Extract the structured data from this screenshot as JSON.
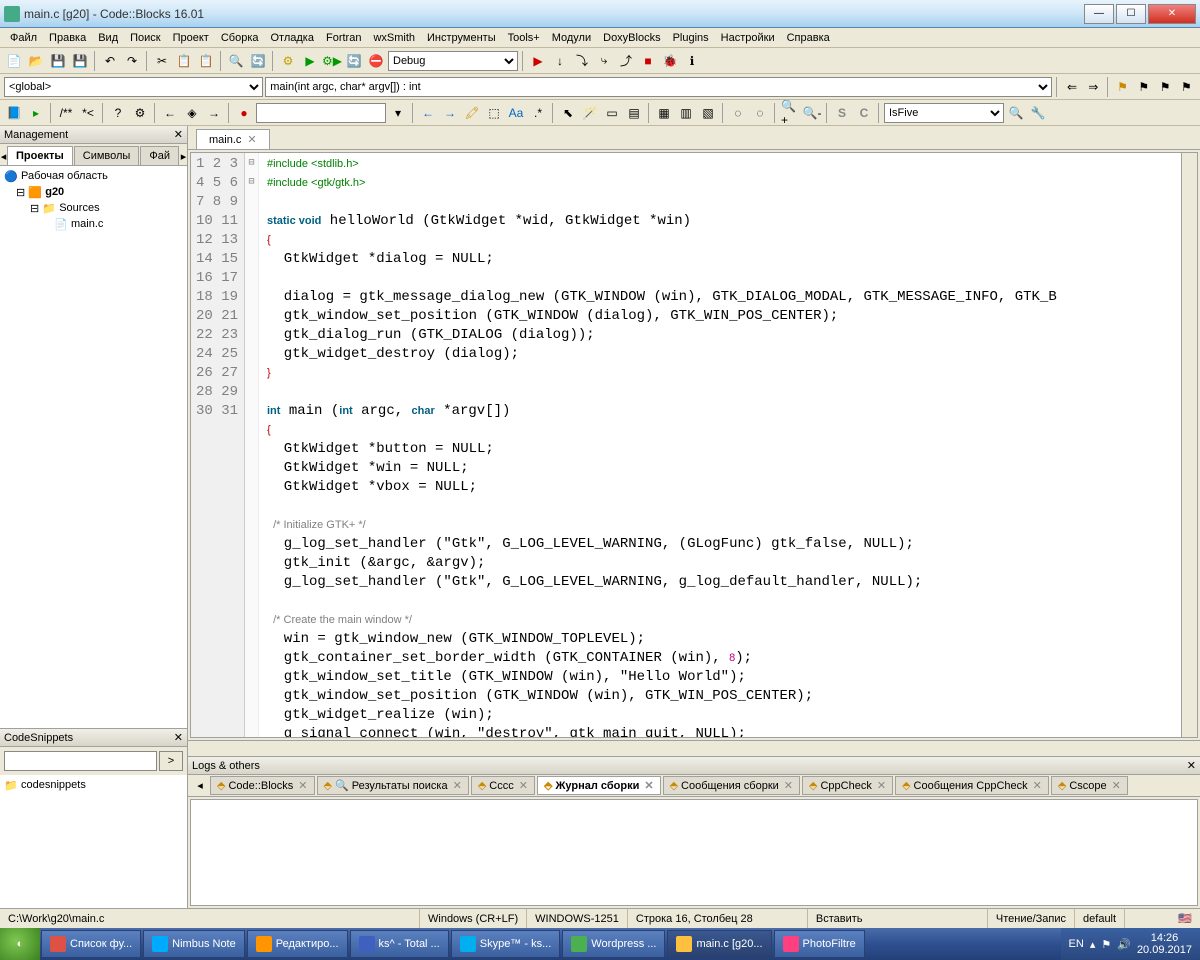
{
  "window": {
    "title": "main.c [g20] - Code::Blocks 16.01"
  },
  "menu": [
    "Файл",
    "Правка",
    "Вид",
    "Поиск",
    "Проект",
    "Сборка",
    "Отладка",
    "Fortran",
    "wxSmith",
    "Инструменты",
    "Tools+",
    "Модули",
    "DoxyBlocks",
    "Plugins",
    "Настройки",
    "Справка"
  ],
  "toolbar2": {
    "target": "Debug"
  },
  "toolbar3": {
    "scope": "<global>",
    "func": "main(int argc, char* argv[]) : int"
  },
  "toolbar5": {
    "id": "IsFive"
  },
  "sidebar": {
    "title": "Management",
    "tabs": [
      "Проекты",
      "Символы",
      "Фай"
    ],
    "tree": {
      "workspace": "Рабочая область",
      "project": "g20",
      "folder": "Sources",
      "file": "main.c"
    }
  },
  "snippets": {
    "title": "CodeSnippets",
    "root": "codesnippets"
  },
  "file_tab": "main.c",
  "code_lines": [
    {
      "n": 1,
      "t": "pp",
      "s": "#include <stdlib.h>"
    },
    {
      "n": 2,
      "t": "pp",
      "s": "#include <gtk/gtk.h>"
    },
    {
      "n": 3,
      "t": "",
      "s": ""
    },
    {
      "n": 4,
      "t": "mix",
      "s": "static void helloWorld (GtkWidget *wid, GtkWidget *win)"
    },
    {
      "n": 5,
      "t": "br",
      "s": "{"
    },
    {
      "n": 6,
      "t": "",
      "s": "  GtkWidget *dialog = NULL;"
    },
    {
      "n": 7,
      "t": "",
      "s": ""
    },
    {
      "n": 8,
      "t": "",
      "s": "  dialog = gtk_message_dialog_new (GTK_WINDOW (win), GTK_DIALOG_MODAL, GTK_MESSAGE_INFO, GTK_B"
    },
    {
      "n": 9,
      "t": "",
      "s": "  gtk_window_set_position (GTK_WINDOW (dialog), GTK_WIN_POS_CENTER);"
    },
    {
      "n": 10,
      "t": "",
      "s": "  gtk_dialog_run (GTK_DIALOG (dialog));"
    },
    {
      "n": 11,
      "t": "",
      "s": "  gtk_widget_destroy (dialog);"
    },
    {
      "n": 12,
      "t": "br",
      "s": "}"
    },
    {
      "n": 13,
      "t": "",
      "s": ""
    },
    {
      "n": 14,
      "t": "mix2",
      "s": "int main (int argc, char *argv[])"
    },
    {
      "n": 15,
      "t": "br",
      "s": "{"
    },
    {
      "n": 16,
      "t": "",
      "s": "  GtkWidget *button = NULL;"
    },
    {
      "n": 17,
      "t": "",
      "s": "  GtkWidget *win = NULL;"
    },
    {
      "n": 18,
      "t": "",
      "s": "  GtkWidget *vbox = NULL;"
    },
    {
      "n": 19,
      "t": "",
      "s": ""
    },
    {
      "n": 20,
      "t": "cmt",
      "s": "  /* Initialize GTK+ */"
    },
    {
      "n": 21,
      "t": "str1",
      "s": "  g_log_set_handler (\"Gtk\", G_LOG_LEVEL_WARNING, (GLogFunc) gtk_false, NULL);"
    },
    {
      "n": 22,
      "t": "",
      "s": "  gtk_init (&argc, &argv);"
    },
    {
      "n": 23,
      "t": "str1",
      "s": "  g_log_set_handler (\"Gtk\", G_LOG_LEVEL_WARNING, g_log_default_handler, NULL);"
    },
    {
      "n": 24,
      "t": "",
      "s": ""
    },
    {
      "n": 25,
      "t": "cmt",
      "s": "  /* Create the main window */"
    },
    {
      "n": 26,
      "t": "",
      "s": "  win = gtk_window_new (GTK_WINDOW_TOPLEVEL);"
    },
    {
      "n": 27,
      "t": "num1",
      "s": "  gtk_container_set_border_width (GTK_CONTAINER (win), 8);"
    },
    {
      "n": 28,
      "t": "str2",
      "s": "  gtk_window_set_title (GTK_WINDOW (win), \"Hello World\");"
    },
    {
      "n": 29,
      "t": "",
      "s": "  gtk_window_set_position (GTK_WINDOW (win), GTK_WIN_POS_CENTER);"
    },
    {
      "n": 30,
      "t": "",
      "s": "  gtk_widget_realize (win);"
    },
    {
      "n": 31,
      "t": "str3",
      "s": "  g_signal_connect (win, \"destroy\", gtk_main_quit, NULL);"
    }
  ],
  "logs": {
    "title": "Logs & others",
    "tabs": [
      "Code::Blocks",
      "Результаты поиска",
      "Cccc",
      "Журнал сборки",
      "Сообщения сборки",
      "CppCheck",
      "Сообщения CppCheck",
      "Cscope"
    ],
    "active": 3
  },
  "status": {
    "path": "C:\\Work\\g20\\main.c",
    "eol": "Windows (CR+LF)",
    "enc": "WINDOWS-1251",
    "pos": "Строка 16, Столбец 28",
    "ins": "Вставить",
    "rw": "Чтение/Запис",
    "lang": "default"
  },
  "taskbar": {
    "items": [
      {
        "label": "Список фу...",
        "color": "#de5246"
      },
      {
        "label": "Nimbus Note",
        "color": "#00aaff"
      },
      {
        "label": "Редактиро...",
        "color": "#ff9500"
      },
      {
        "label": "ks^ - Total ...",
        "color": "#4060c0"
      },
      {
        "label": "Skype™ - ks...",
        "color": "#00aff0"
      },
      {
        "label": "Wordpress ...",
        "color": "#4caf50"
      },
      {
        "label": "main.c [g20...",
        "color": "#ffc040",
        "active": true
      },
      {
        "label": "PhotoFiltre",
        "color": "#ff4080"
      }
    ],
    "lang": "EN",
    "time": "14:26",
    "date": "20.09.2017"
  }
}
